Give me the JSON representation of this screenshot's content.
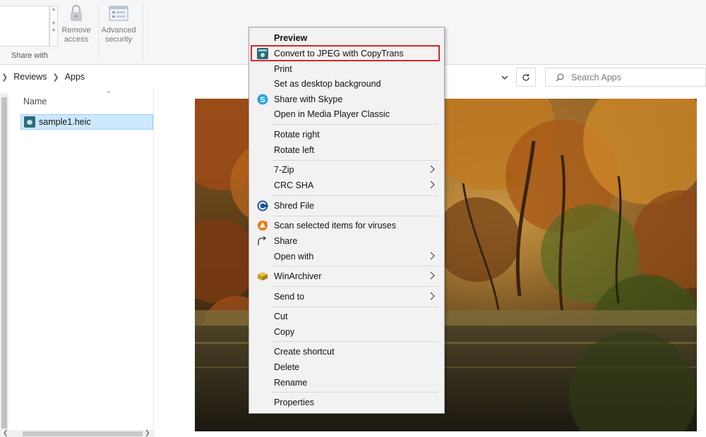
{
  "ribbon": {
    "share_group_label": "Share with",
    "remove_access_label": "Remove access",
    "remove_access_line1": "Remove",
    "remove_access_line2": "access",
    "advanced_security_line1": "Advanced",
    "advanced_security_line2": "security"
  },
  "address": {
    "breadcrumbs": [
      "Reviews",
      "Apps"
    ]
  },
  "search": {
    "placeholder": "Search Apps"
  },
  "file_list": {
    "column_name": "Name",
    "files": [
      {
        "name": "sample1.heic",
        "selected": true
      }
    ]
  },
  "context_menu": {
    "items": [
      {
        "label": "Preview",
        "bold": true
      },
      {
        "label": "Convert to JPEG with CopyTrans",
        "icon": "copytrans-icon",
        "highlighted": true
      },
      {
        "label": "Print"
      },
      {
        "label": "Set as desktop background"
      },
      {
        "label": "Share with Skype",
        "icon": "skype-icon"
      },
      {
        "label": "Open in Media Player Classic"
      },
      {
        "label": "Rotate right"
      },
      {
        "label": "Rotate left"
      },
      {
        "label": "7-Zip",
        "submenu": true
      },
      {
        "label": "CRC SHA",
        "submenu": true
      },
      {
        "label": "Shred File",
        "icon": "shred-icon"
      },
      {
        "label": "Scan selected items for viruses",
        "icon": "avast-icon"
      },
      {
        "label": "Share",
        "icon": "share-icon"
      },
      {
        "label": "Open with",
        "submenu": true
      },
      {
        "label": "WinArchiver",
        "icon": "winarchiver-icon",
        "submenu": true
      },
      {
        "label": "Send to",
        "submenu": true
      },
      {
        "label": "Cut"
      },
      {
        "label": "Copy"
      },
      {
        "label": "Create shortcut"
      },
      {
        "label": "Delete"
      },
      {
        "label": "Rename"
      },
      {
        "label": "Properties"
      }
    ]
  },
  "colors": {
    "selection_bg": "#cce8ff",
    "selection_border": "#99d1ff",
    "highlight_border": "#d4262a",
    "menu_bg": "#f2f2f2"
  }
}
